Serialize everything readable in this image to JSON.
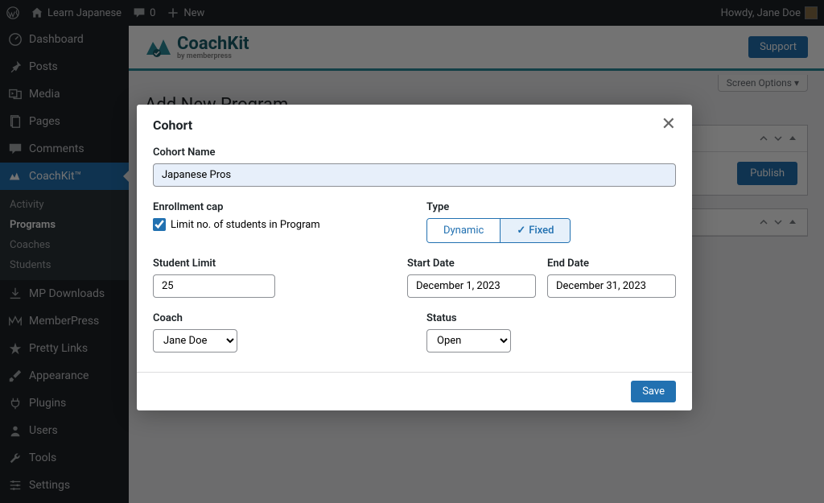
{
  "adminbar": {
    "site_name": "Learn Japanese",
    "comments": "0",
    "new": "New",
    "howdy": "Howdy, Jane Doe"
  },
  "sidebar": {
    "dashboard": "Dashboard",
    "posts": "Posts",
    "media": "Media",
    "pages": "Pages",
    "comments": "Comments",
    "coachkit": "CoachKit™",
    "submenu": {
      "activity": "Activity",
      "programs": "Programs",
      "coaches": "Coaches",
      "students": "Students"
    },
    "mp_downloads": "MP Downloads",
    "memberpress": "MemberPress",
    "pretty_links": "Pretty Links",
    "appearance": "Appearance",
    "plugins": "Plugins",
    "users": "Users",
    "tools": "Tools",
    "settings": "Settings"
  },
  "brand": {
    "name": "CoachKit",
    "by": "by memberpress",
    "support": "Support"
  },
  "screen_options": "Screen Options",
  "page_title": "Add New Program",
  "publish": "Publish",
  "modal": {
    "title": "Cohort",
    "cohort_name_label": "Cohort Name",
    "cohort_name_value": "Japanese Pros",
    "enrollment_cap_label": "Enrollment cap",
    "limit_checkbox_label": "Limit no. of students in Program",
    "type_label": "Type",
    "type_dynamic": "Dynamic",
    "type_fixed": "Fixed",
    "student_limit_label": "Student Limit",
    "student_limit_value": "25",
    "start_date_label": "Start Date",
    "start_date_value": "December 1, 2023",
    "end_date_label": "End Date",
    "end_date_value": "December 31, 2023",
    "coach_label": "Coach",
    "coach_value": "Jane Doe",
    "status_label": "Status",
    "status_value": "Open",
    "save": "Save"
  }
}
